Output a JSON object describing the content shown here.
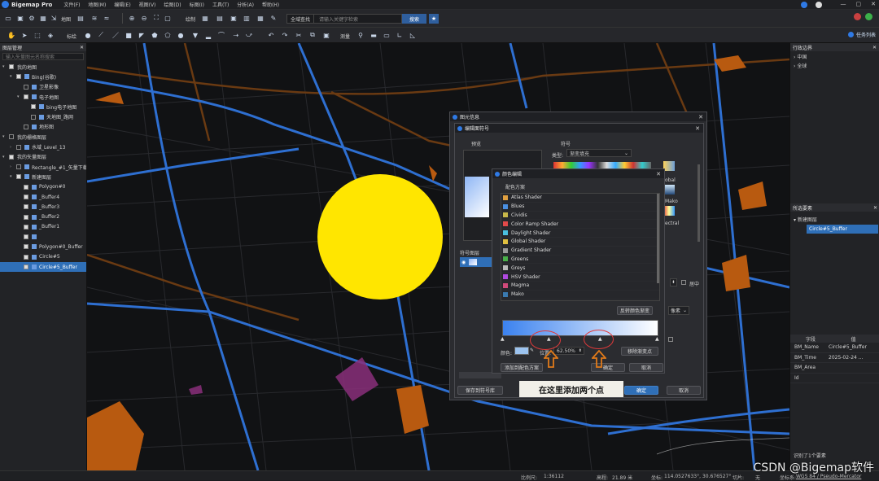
{
  "app": {
    "title": "Bigemap Pro",
    "menu": [
      "文件(F)",
      "地图(M)",
      "编辑(E)",
      "视图(V)",
      "绘图(D)",
      "标图(I)",
      "工具(T)",
      "分析(A)",
      "帮助(H)"
    ]
  },
  "toolbar": {
    "label_map": "地图",
    "label_draw_mode": "绘制",
    "label_measure": "测量",
    "label_calc": "标绘",
    "search_scope": "全域查找",
    "search_placeholder": "请输入关键字检索",
    "search_button": "搜索",
    "task_list": "任务列表"
  },
  "left_panel": {
    "title": "图层管理",
    "search_placeholder": "输入矢量图元名称搜索",
    "items": [
      {
        "label": "我的地图",
        "level": 0,
        "checked": true,
        "arrow": "▾"
      },
      {
        "label": "Bing(谷歌)",
        "level": 1,
        "checked": true,
        "arrow": "▾"
      },
      {
        "label": "卫星影像",
        "level": 2,
        "checked": false,
        "arrow": ""
      },
      {
        "label": "电子地图",
        "level": 2,
        "checked": true,
        "arrow": "▾"
      },
      {
        "label": "bing电子地图",
        "level": 3,
        "checked": true,
        "arrow": ""
      },
      {
        "label": "天地图_路网",
        "level": 3,
        "checked": false,
        "arrow": ""
      },
      {
        "label": "地形图",
        "level": 2,
        "checked": false,
        "arrow": ""
      },
      {
        "label": "我的栅格图层",
        "level": 0,
        "checked": false,
        "arrow": "▾"
      },
      {
        "label": "水域_Level_13",
        "level": 1,
        "checked": false,
        "arrow": "›"
      },
      {
        "label": "我的矢量图层",
        "level": 0,
        "checked": true,
        "arrow": "▾"
      },
      {
        "label": "Rectangle_#1_矢量下载(0)",
        "level": 1,
        "checked": false,
        "arrow": "›"
      },
      {
        "label": "新建图层",
        "level": 1,
        "checked": true,
        "arrow": "▾"
      },
      {
        "label": "Polygon#0",
        "level": 2,
        "checked": true,
        "arrow": ""
      },
      {
        "label": "_Buffer4",
        "level": 2,
        "checked": true,
        "arrow": ""
      },
      {
        "label": "_Buffer3",
        "level": 2,
        "checked": true,
        "arrow": ""
      },
      {
        "label": "_Buffer2",
        "level": 2,
        "checked": true,
        "arrow": ""
      },
      {
        "label": "_Buffer1",
        "level": 2,
        "checked": true,
        "arrow": ""
      },
      {
        "label": "",
        "level": 2,
        "checked": true,
        "arrow": ""
      },
      {
        "label": "Polygon#0_Buffer",
        "level": 2,
        "checked": true,
        "arrow": ""
      },
      {
        "label": "Circle#5",
        "level": 2,
        "checked": true,
        "arrow": ""
      },
      {
        "label": "Circle#5_Buffer",
        "level": 2,
        "checked": true,
        "arrow": "",
        "selected": true
      }
    ]
  },
  "right_panel": {
    "admin_title": "行政边界",
    "admin_items": [
      "中国",
      "全球"
    ],
    "selected_title": "所选要素",
    "selected_tree": [
      "新建图层",
      "Circle#5_Buffer"
    ],
    "attr_headers": [
      "字段",
      "值"
    ],
    "attrs": [
      {
        "k": "BM_Name",
        "v": "Circle#5_Buffer"
      },
      {
        "k": "BM_Time",
        "v": "2025-02-24 ..."
      },
      {
        "k": "BM_Area",
        "v": ""
      },
      {
        "k": "Id",
        "v": ""
      }
    ],
    "selected_count": "识别了1个要素"
  },
  "dialog_info": {
    "title": "图元信息"
  },
  "dialog_symbol": {
    "title": "编辑面符号",
    "preview_label": "预览",
    "symbol_label": "符号",
    "type_label": "类型:",
    "type_value": "渐变填充",
    "layer_label": "符号图层",
    "hollow_label": "居中",
    "unit_value": "像素",
    "save_to_lib": "保存到符号库",
    "ok": "确定",
    "cancel": "取消",
    "swatch_labels": [
      "obal",
      "Mako",
      "ectral"
    ]
  },
  "dialog_color": {
    "title": "颜色编辑",
    "scheme_label": "配色方案",
    "shaders": [
      {
        "name": "Atlas Shader",
        "color": "#e0a040"
      },
      {
        "name": "Blues",
        "color": "#4a8fe0"
      },
      {
        "name": "Cividis",
        "color": "#c8b84a"
      },
      {
        "name": "Color Ramp Shader",
        "color": "#e24a4a"
      },
      {
        "name": "Daylight Shader",
        "color": "#4ac0e0"
      },
      {
        "name": "Global Shader",
        "color": "#e0c040"
      },
      {
        "name": "Gradient Shader",
        "color": "#9a9a9a"
      },
      {
        "name": "Greens",
        "color": "#4ab04a"
      },
      {
        "name": "Greys",
        "color": "#bbbbbb"
      },
      {
        "name": "HSV Shader",
        "color": "#b04ae0"
      },
      {
        "name": "Magma",
        "color": "#d04a7a"
      },
      {
        "name": "Mako",
        "color": "#3a7ab0"
      }
    ],
    "reverse_button": "反转颜色渐变",
    "color_label": "颜色:",
    "position_label": "位置:",
    "position_value": "62.50%",
    "remove_stop": "移除渐变点",
    "add_to_scheme": "添加到配色方案",
    "ok": "确定",
    "cancel": "取消",
    "grad_start": "#3b82ef",
    "grad_end": "#ffffff"
  },
  "annotation": {
    "callout": "在这里添加两个点"
  },
  "status": {
    "scale_label": "比例尺:",
    "scale_value": "1:36112",
    "zoom_label": "高程:",
    "zoom_value": "21.89 米",
    "coord_label": "坐标:",
    "coord_value": "114.0527633°, 30.676527°",
    "tile_label": "切片:",
    "tile_value": "无",
    "crs_label": "坐标系:",
    "crs_value": "WGS 84 / Pseudo-Mercator"
  },
  "watermark": "CSDN @Bigemap软件",
  "colors": {
    "accent": "#2f6fb7",
    "circle": "#ffe600",
    "road": "#2e6fd1",
    "orange": "#c0580d"
  }
}
